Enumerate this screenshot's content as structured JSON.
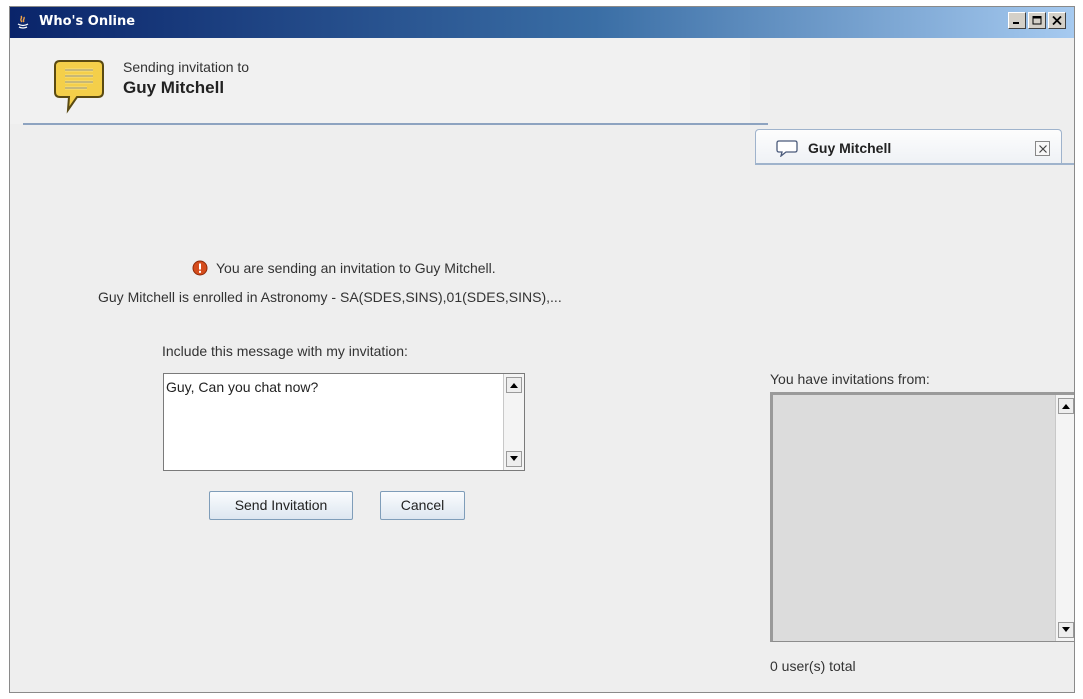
{
  "window": {
    "title": "Who's Online",
    "controls": [
      "minimize-icon",
      "maximize-icon",
      "close-icon"
    ]
  },
  "header": {
    "sending_label": "Sending invitation to",
    "recipient": "Guy Mitchell",
    "icon": "speech-bubble-icon"
  },
  "notice": {
    "warning_text": "You are sending an invitation to Guy Mitchell.",
    "enrollment_text": "Guy Mitchell is enrolled in Astronomy - SA(SDES,SINS),01(SDES,SINS),..."
  },
  "message": {
    "label": "Include this message with my invitation:",
    "value": "Guy, Can you chat now?"
  },
  "buttons": {
    "send": "Send Invitation",
    "cancel": "Cancel"
  },
  "side_panel": {
    "tab_name": "Guy Mitchell",
    "invitations_label": "You have invitations from:",
    "total_label": "0 user(s) total",
    "invitations": []
  },
  "colors": {
    "titlebar_start": "#0a246a",
    "titlebar_end": "#a6caf0",
    "header_rule": "#8da3c0",
    "warning": "#d54c1c"
  }
}
